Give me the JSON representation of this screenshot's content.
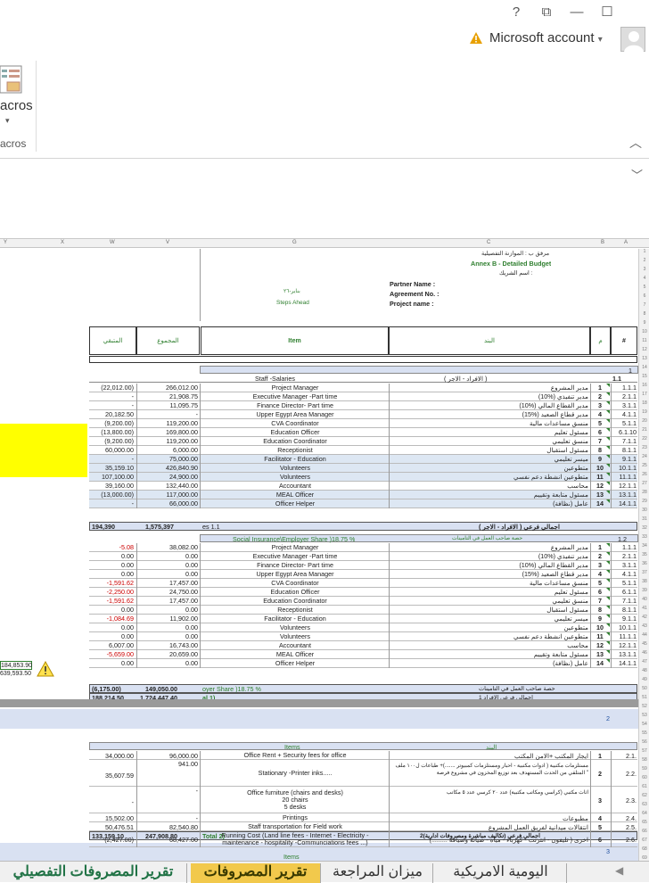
{
  "window": {
    "help": "?",
    "restore": "⧉",
    "minimize": "—",
    "maximize": "☐",
    "account_label": "Microsoft account",
    "account_caret": "▾"
  },
  "ribbon": {
    "macros_button": "acros",
    "macros_caret": "▾",
    "group_label": "acros",
    "collapse": "︿"
  },
  "formula": {
    "expand": "﹀"
  },
  "columns": [
    "Y",
    "X",
    "W",
    "V",
    "G",
    "C",
    "B",
    "A"
  ],
  "header": {
    "line1": "مرفق ب : الموازنة التفصيلية",
    "line2": "Annex B - Detailed Budget",
    "line3": "اسم الشريك :",
    "partner": "Partner Name :",
    "agreement": "Agreement No. :",
    "project": "Project name :",
    "left1": "بناير-٢٦",
    "left2": "Steps Ahead"
  },
  "table_head": {
    "hash": "#",
    "m": "م",
    "band": "البند",
    "item": "Item",
    "total": "المجموع",
    "remaining": "المتبقي"
  },
  "sec1": {
    "num": "1",
    "sub": "1.1",
    "ar": "( الافراد - الاجر )",
    "en": "Staff -Salaries"
  },
  "salaries": [
    [
      "1.1.1",
      "1",
      "مدير المشروع",
      "Project Manager",
      "266,012.00",
      "(22,012.00)"
    ],
    [
      "2.1.1",
      "2",
      "(10%) مدير تنفيذي",
      "Executive Manager -Part time",
      "21,908.75",
      "-"
    ],
    [
      "3.1.1",
      "3",
      "(10%) مدير القطاع المالي",
      "Finance Director- Part time",
      "11,095.75",
      "-"
    ],
    [
      "4.1.1",
      "4",
      "(15%) مدير قطاع الصعيد",
      "Upper Egypt Area Manager",
      "-",
      "20,182.50"
    ],
    [
      "5.1.1",
      "5",
      "منسق مساعدات مالية",
      "CVA Coordinator",
      "119,200.00",
      "(9,200.00)"
    ],
    [
      "6.1.10",
      "6",
      "مسئول تعليم",
      "Education Officer",
      "169,800.00",
      "(13,800.00)"
    ],
    [
      "7.1.1",
      "7",
      "منسق تعليمي",
      "Education Coordinator",
      "119,200.00",
      "(9,200.00)"
    ],
    [
      "8.1.1",
      "8",
      "مسئول استقبال",
      "Receptionist",
      "6,000.00",
      "60,000.00"
    ],
    [
      "9.1.1",
      "9",
      "ميسر تعليمي",
      "Facilitator - Education",
      "75,000.00",
      "-"
    ],
    [
      "10.1.1",
      "10",
      "متطوعين",
      "Volunteers",
      "426,840.90",
      "35,159.10"
    ],
    [
      "11.1.1",
      "11",
      "متطوعين انشطة دعم نفسي",
      "Volunteers",
      "24,900.00",
      "107,100.00"
    ],
    [
      "12.1.1",
      "12",
      "محاسب",
      "Accountant",
      "132,440.00",
      "39,160.00"
    ],
    [
      "13.1.1",
      "13",
      "مسئول متابعة وتقييم",
      "MEAL Officer",
      "117,000.00",
      "(13,000.00)"
    ],
    [
      "14.1.1",
      "14",
      "عامل (نظافة)",
      "Officer Helper",
      "66,000.00",
      "-"
    ]
  ],
  "sal_total": {
    "ar": "اجمالي فرعي ( الافراد - الاجر )",
    "en": "es 1.1",
    "total": "1,575,397",
    "remaining": "194,390"
  },
  "sec12": {
    "num": "1.2",
    "ar": "حصة صاحب العمل في التامينات",
    "en": "Social Insurance\\Employer Share )18.75 %"
  },
  "insurance": [
    [
      "1.1.1",
      "1",
      "مدير المشروع",
      "Project Manager",
      "38,082.00",
      "-5.08"
    ],
    [
      "2.1.1",
      "2",
      "(10%) مدير تنفيذي",
      "Executive Manager -Part time",
      "0.00",
      "0.00"
    ],
    [
      "3.1.1",
      "3",
      "(10%) مدير القطاع المالي",
      "Finance Director- Part time",
      "0.00",
      "0.00"
    ],
    [
      "4.1.1",
      "4",
      "(15%) مدير قطاع الصعيد",
      "Upper Egypt Area Manager",
      "0.00",
      "0.00"
    ],
    [
      "5.1.1",
      "5",
      "منسق مساعدات مالية",
      "CVA Coordinator",
      "17,457.00",
      "-1,591.62"
    ],
    [
      "6.1.1",
      "6",
      "مسئول تعليم",
      "Education Officer",
      "24,750.00",
      "-2,250.00"
    ],
    [
      "7.1.1",
      "7",
      "منسق تعليمي",
      "Education Coordinator",
      "17,457.00",
      "-1,591.62"
    ],
    [
      "8.1.1",
      "8",
      "مسئول استقبال",
      "Receptionist",
      "0.00",
      "0.00"
    ],
    [
      "9.1.1",
      "9",
      "ميسر تعليمي",
      "Facilitator - Education",
      "11,902.00",
      "-1,084.69"
    ],
    [
      "10.1.1",
      "10",
      "متطوعين",
      "Volunteers",
      "0.00",
      "0.00"
    ],
    [
      "11.1.1",
      "11",
      "متطوعين انشطة دعم نفسي",
      "Volunteers",
      "0.00",
      "0.00"
    ],
    [
      "12.1.1",
      "12",
      "محاسب",
      "Accountant",
      "16,743.00",
      "6,007.00"
    ],
    [
      "13.1.1",
      "13",
      "مسئول متابعة وتقييم",
      "MEAL Officer",
      "20,659.00",
      "-5,659.00"
    ],
    [
      "14.1.1",
      "14",
      "عامل (نظافة)",
      "Officer Helper",
      "0.00",
      "0.00"
    ]
  ],
  "ins_total": {
    "ar": "حصة صاحب العمل في التامينات",
    "en": "oyer Share )18.75 %",
    "total": "149,050.00",
    "remaining": "(6,175.00)"
  },
  "grand1": {
    "ar": "اجمالي فرعي الافراد 1",
    "en": "al 1)",
    "total": "1,724,447.40",
    "remaining": "188,214.50"
  },
  "side_values": [
    "184,853.90",
    "639,593.50"
  ],
  "sec2": {
    "num": "2",
    "ar": "البند",
    "en": "Items"
  },
  "admin": [
    {
      "a": "2.1.",
      "m": "1",
      "ar": "ايجار المكتب +الامن المكتب",
      "en": [
        "Office Rent + Security fees for office"
      ],
      "total": "96,000.00",
      "rem": "34,000.00"
    },
    {
      "a": "2.2.",
      "m": "2",
      "ar": "مستلزمات مكتبية ( ادوات مكتبية - احبار ومستلزمات كمبيوتر .......)+ طباعات ل١٠٠ ملف \" المتلقي من الحدث المستهدف بعد توزيع المخزون في مشروع فرصة",
      "en": [
        "Stationary -Printer inks....."
      ],
      "total": "941.00",
      "rem": "35,607.59"
    },
    {
      "a": "2.3.",
      "m": "3",
      "ar": "اثاث مكتبي (كراسي ومكاتب مكتبية) عدد ٢٠ كرسي عدد ٥ مكاتب",
      "en": [
        "Office furniture (chairs and desks)",
        "20 chairs",
        "5 desks"
      ],
      "total": "-",
      "rem": "-"
    },
    {
      "a": "2.4.",
      "m": "4",
      "ar": "مطبوعات",
      "en": [
        "Printings"
      ],
      "total": "-",
      "rem": "15,502.00"
    },
    {
      "a": "2.5.",
      "m": "5",
      "ar": "انتقالات ميدانية لفريق العمل المشروع",
      "en": [
        "Staff transportation for Field work"
      ],
      "total": "82,540.80",
      "rem": "50,476.51"
    },
    {
      "a": "2.6.",
      "m": "6",
      "ar": "اخرى ( تليفون - انترنت - كهرباء - مياه - صيانة وصيافة .........)",
      "en": [
        "Running Cost (Land line fees - Internet - Electricity -",
        "maintenance - hospitality -Communciations fees ...)"
      ],
      "total": "68,427.00",
      "rem": "(2,427.00)"
    }
  ],
  "admin_total": {
    "ar": "اجمالي فرعي (تكاليف مباشرة ومصروفات ادارية)2",
    "en": "Total 2)",
    "total": "247,908.80",
    "remaining": "133,159.10"
  },
  "sec3": {
    "num": "3",
    "en": "Items"
  },
  "tabs": [
    "تقرير المصروفات التفصيلي",
    "تقرير المصروفات",
    "ميزان المراجعة",
    "اليومية الامريكية"
  ],
  "tab_arrow": "◀"
}
